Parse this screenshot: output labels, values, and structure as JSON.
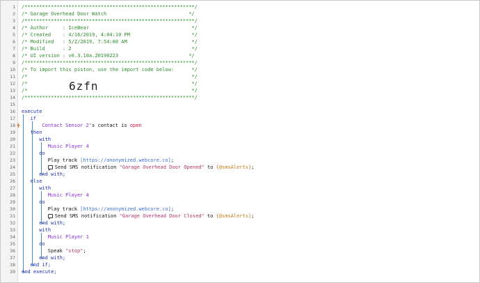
{
  "editor": {
    "lines": [
      {
        "n": "1",
        "indent": 0,
        "tokens": [
          {
            "c": "cm",
            "t": "/**********************************************************/"
          }
        ]
      },
      {
        "n": "2",
        "indent": 0,
        "tokens": [
          {
            "c": "cm",
            "t": "/* Garage Overhead Door Watch                            */"
          }
        ]
      },
      {
        "n": "3",
        "indent": 0,
        "tokens": [
          {
            "c": "cm",
            "t": "/**********************************************************/"
          }
        ]
      },
      {
        "n": "4",
        "indent": 0,
        "tokens": [
          {
            "c": "cm",
            "t": "/* Author     : IceBear                                   */"
          }
        ]
      },
      {
        "n": "5",
        "indent": 0,
        "tokens": [
          {
            "c": "cm",
            "t": "/* Created    : 4/16/2019, 4:04:10 PM                     */"
          }
        ]
      },
      {
        "n": "6",
        "indent": 0,
        "tokens": [
          {
            "c": "cm",
            "t": "/* Modified   : 5/2/2019, 7:54:00 AM                      */"
          }
        ]
      },
      {
        "n": "7",
        "indent": 0,
        "tokens": [
          {
            "c": "cm",
            "t": "/* Build      : 2                                         */"
          }
        ]
      },
      {
        "n": "8",
        "indent": 0,
        "tokens": [
          {
            "c": "cm",
            "t": "/* UI version : v0.3.10a.20190223                        */"
          }
        ]
      },
      {
        "n": "9",
        "indent": 0,
        "tokens": [
          {
            "c": "cm",
            "t": "/**********************************************************/"
          }
        ]
      },
      {
        "n": "10",
        "indent": 0,
        "tokens": [
          {
            "c": "cm",
            "t": "/* To import this piston, use the import code below:      */"
          }
        ]
      },
      {
        "n": "11",
        "indent": 0,
        "tokens": [
          {
            "c": "cm",
            "t": "/*                                                        */"
          }
        ]
      },
      {
        "n": "12",
        "indent": 0,
        "tokens": [
          {
            "c": "cm",
            "t": "/*                                                        */"
          }
        ]
      },
      {
        "n": "13",
        "indent": 0,
        "tokens": [
          {
            "c": "cm",
            "t": "/*                                                        */"
          }
        ]
      },
      {
        "n": "14",
        "indent": 0,
        "tokens": [
          {
            "c": "cm",
            "t": "/**********************************************************/"
          }
        ]
      },
      {
        "n": "15",
        "indent": 0,
        "tokens": []
      },
      {
        "n": "16",
        "indent": 0,
        "tokens": [
          {
            "c": "kw",
            "t": "execute"
          }
        ]
      },
      {
        "n": "17",
        "indent": 3,
        "tokens": [
          {
            "c": "kw",
            "t": "if"
          }
        ]
      },
      {
        "n": "18",
        "indent": 7,
        "tokens": [
          {
            "c": "dev",
            "t": "Contact Sensor 2"
          },
          {
            "c": "txt",
            "t": "'s contact is "
          },
          {
            "c": "val",
            "t": "open"
          }
        ]
      },
      {
        "n": "19",
        "indent": 3,
        "tokens": [
          {
            "c": "kw",
            "t": "then"
          }
        ]
      },
      {
        "n": "20",
        "indent": 6,
        "tokens": [
          {
            "c": "kw",
            "t": "with"
          }
        ]
      },
      {
        "n": "21",
        "indent": 9,
        "tokens": [
          {
            "c": "dev",
            "t": "Music Player 4"
          }
        ]
      },
      {
        "n": "22",
        "indent": 6,
        "tokens": [
          {
            "c": "kw",
            "t": "do"
          }
        ]
      },
      {
        "n": "23",
        "indent": 9,
        "tokens": [
          {
            "c": "txt",
            "t": "Play track "
          },
          {
            "c": "url",
            "t": "[https://anonymized.webcore.co]"
          },
          {
            "c": "txt",
            "t": ";"
          }
        ]
      },
      {
        "n": "24",
        "indent": 9,
        "icon": true,
        "tokens": [
          {
            "c": "txt",
            "t": "Send SMS notification "
          },
          {
            "c": "str",
            "t": "\"Garage Overhead Door Opened\""
          },
          {
            "c": "txt",
            "t": " to "
          },
          {
            "c": "var",
            "t": "{@smsAlerts}"
          },
          {
            "c": "txt",
            "t": ";"
          }
        ]
      },
      {
        "n": "25",
        "indent": 6,
        "tokens": [
          {
            "c": "kw",
            "t": "end with;"
          }
        ]
      },
      {
        "n": "26",
        "indent": 3,
        "tokens": [
          {
            "c": "kw",
            "t": "else"
          }
        ]
      },
      {
        "n": "27",
        "indent": 6,
        "tokens": [
          {
            "c": "kw",
            "t": "with"
          }
        ]
      },
      {
        "n": "28",
        "indent": 9,
        "tokens": [
          {
            "c": "dev",
            "t": "Music Player 4"
          }
        ]
      },
      {
        "n": "29",
        "indent": 6,
        "tokens": [
          {
            "c": "kw",
            "t": "do"
          }
        ]
      },
      {
        "n": "30",
        "indent": 9,
        "tokens": [
          {
            "c": "txt",
            "t": "Play track "
          },
          {
            "c": "url",
            "t": "[https://anonymized.webcore.co]"
          },
          {
            "c": "txt",
            "t": ";"
          }
        ]
      },
      {
        "n": "31",
        "indent": 9,
        "icon": true,
        "tokens": [
          {
            "c": "txt",
            "t": "Send SMS notification "
          },
          {
            "c": "str",
            "t": "\"Garage Overhead Door Closed\""
          },
          {
            "c": "txt",
            "t": " to "
          },
          {
            "c": "var",
            "t": "{@smsAlerts}"
          },
          {
            "c": "txt",
            "t": ";"
          }
        ]
      },
      {
        "n": "32",
        "indent": 6,
        "tokens": [
          {
            "c": "kw",
            "t": "end with;"
          }
        ]
      },
      {
        "n": "33",
        "indent": 6,
        "tokens": [
          {
            "c": "kw",
            "t": "with"
          }
        ]
      },
      {
        "n": "34",
        "indent": 9,
        "tokens": [
          {
            "c": "dev",
            "t": "Music Player 1"
          }
        ]
      },
      {
        "n": "35",
        "indent": 6,
        "tokens": [
          {
            "c": "kw",
            "t": "do"
          }
        ]
      },
      {
        "n": "36",
        "indent": 9,
        "tokens": [
          {
            "c": "txt",
            "t": "Speak "
          },
          {
            "c": "str",
            "t": "\"stop\""
          },
          {
            "c": "txt",
            "t": ";"
          }
        ]
      },
      {
        "n": "37",
        "indent": 6,
        "tokens": [
          {
            "c": "kw",
            "t": "end with;"
          }
        ]
      },
      {
        "n": "38",
        "indent": 3,
        "tokens": [
          {
            "c": "kw",
            "t": "end if;"
          }
        ]
      },
      {
        "n": "39",
        "indent": 0,
        "tokens": [
          {
            "c": "kw",
            "t": "end execute;"
          }
        ]
      }
    ],
    "import_code": "6zfn",
    "trigger_icon": "lightning-bolt-icon",
    "message_icon": "speech-bubble-icon",
    "colors": {
      "comment": "#2e8b2e",
      "keyword": "#1a2fb0",
      "device": "#8a2be2",
      "value": "#d2143a",
      "string": "#b8336a",
      "variable": "#c27a1a",
      "guide": "#4a8bd6"
    }
  }
}
